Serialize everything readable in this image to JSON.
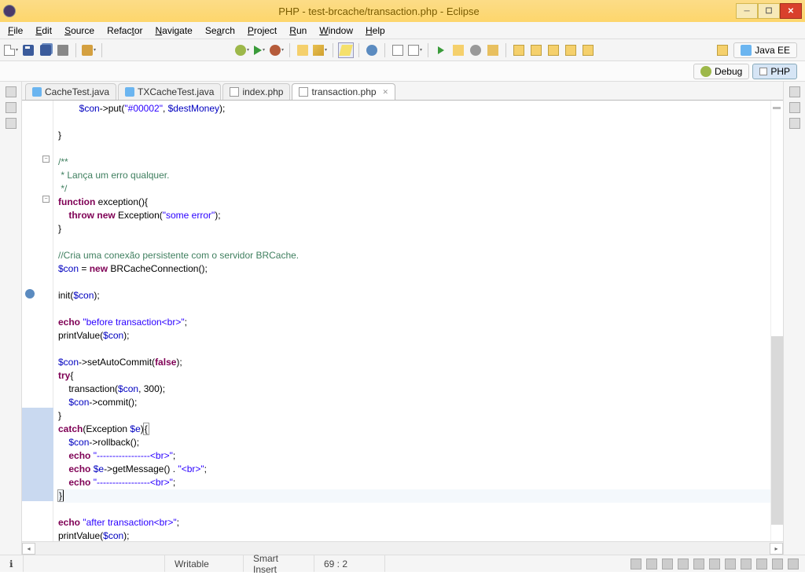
{
  "window": {
    "title": "PHP - test-brcache/transaction.php - Eclipse"
  },
  "menu": [
    "File",
    "Edit",
    "Source",
    "Refactor",
    "Navigate",
    "Search",
    "Project",
    "Run",
    "Window",
    "Help"
  ],
  "perspectives": {
    "java_ee": "Java EE",
    "debug": "Debug",
    "php": "PHP"
  },
  "tabs": [
    {
      "label": "CacheTest.java",
      "type": "j",
      "active": false
    },
    {
      "label": "TXCacheTest.java",
      "type": "j",
      "active": false
    },
    {
      "label": "index.php",
      "type": "p",
      "active": false
    },
    {
      "label": "transaction.php",
      "type": "p",
      "active": true
    }
  ],
  "code": {
    "lines": [
      {
        "indent": 2,
        "tokens": [
          {
            "c": "var",
            "t": "$con"
          },
          {
            "c": "",
            "t": "->put("
          },
          {
            "c": "str",
            "t": "\"#00002\""
          },
          {
            "c": "",
            "t": ", "
          },
          {
            "c": "var",
            "t": "$destMoney"
          },
          {
            "c": "",
            "t": ");"
          }
        ]
      },
      {
        "indent": 0,
        "tokens": []
      },
      {
        "indent": 0,
        "tokens": [
          {
            "c": "",
            "t": "}"
          }
        ]
      },
      {
        "indent": 0,
        "tokens": []
      },
      {
        "indent": 0,
        "fold": "-",
        "tokens": [
          {
            "c": "cm",
            "t": "/**"
          }
        ]
      },
      {
        "indent": 0,
        "tokens": [
          {
            "c": "cm",
            "t": " * Lança um erro qualquer."
          }
        ]
      },
      {
        "indent": 0,
        "tokens": [
          {
            "c": "cm",
            "t": " */"
          }
        ]
      },
      {
        "indent": 0,
        "fold": "-",
        "tokens": [
          {
            "c": "kw",
            "t": "function"
          },
          {
            "c": "",
            "t": " exception(){"
          }
        ]
      },
      {
        "indent": 1,
        "tokens": [
          {
            "c": "kw",
            "t": "throw"
          },
          {
            "c": "",
            "t": " "
          },
          {
            "c": "kw",
            "t": "new"
          },
          {
            "c": "",
            "t": " Exception("
          },
          {
            "c": "str",
            "t": "\"some error\""
          },
          {
            "c": "",
            "t": ");"
          }
        ]
      },
      {
        "indent": 0,
        "tokens": [
          {
            "c": "",
            "t": "}"
          }
        ]
      },
      {
        "indent": 0,
        "tokens": []
      },
      {
        "indent": 0,
        "tokens": [
          {
            "c": "cm",
            "t": "//Cria uma conexão persistente com o servidor BRCache."
          }
        ]
      },
      {
        "indent": 0,
        "tokens": [
          {
            "c": "var",
            "t": "$con"
          },
          {
            "c": "",
            "t": " = "
          },
          {
            "c": "kw",
            "t": "new"
          },
          {
            "c": "",
            "t": " BRCacheConnection();"
          }
        ]
      },
      {
        "indent": 0,
        "tokens": []
      },
      {
        "indent": 0,
        "warn": true,
        "tokens": [
          {
            "c": "",
            "t": "init("
          },
          {
            "c": "var",
            "t": "$con"
          },
          {
            "c": "",
            "t": ");"
          }
        ]
      },
      {
        "indent": 0,
        "tokens": []
      },
      {
        "indent": 0,
        "tokens": [
          {
            "c": "kw",
            "t": "echo"
          },
          {
            "c": "",
            "t": " "
          },
          {
            "c": "str",
            "t": "\"before transaction<br>\""
          },
          {
            "c": "",
            "t": ";"
          }
        ]
      },
      {
        "indent": 0,
        "tokens": [
          {
            "c": "",
            "t": "printValue("
          },
          {
            "c": "var",
            "t": "$con"
          },
          {
            "c": "",
            "t": ");"
          }
        ]
      },
      {
        "indent": 0,
        "tokens": []
      },
      {
        "indent": 0,
        "tokens": [
          {
            "c": "var",
            "t": "$con"
          },
          {
            "c": "",
            "t": "->setAutoCommit("
          },
          {
            "c": "kw",
            "t": "false"
          },
          {
            "c": "",
            "t": ");"
          }
        ]
      },
      {
        "indent": 0,
        "tokens": [
          {
            "c": "kw",
            "t": "try"
          },
          {
            "c": "",
            "t": "{"
          }
        ]
      },
      {
        "indent": 1,
        "tokens": [
          {
            "c": "",
            "t": "transaction("
          },
          {
            "c": "var",
            "t": "$con"
          },
          {
            "c": "",
            "t": ", 300);"
          }
        ]
      },
      {
        "indent": 1,
        "tokens": [
          {
            "c": "var",
            "t": "$con"
          },
          {
            "c": "",
            "t": "->commit();"
          }
        ]
      },
      {
        "indent": 0,
        "hl": true,
        "tokens": [
          {
            "c": "",
            "t": "}"
          }
        ]
      },
      {
        "indent": 0,
        "hl": true,
        "tokens": [
          {
            "c": "kw",
            "t": "catch"
          },
          {
            "c": "",
            "t": "(Exception "
          },
          {
            "c": "var",
            "t": "$e"
          },
          {
            "c": "",
            "t": ")"
          },
          {
            "c": "",
            "t": "{",
            "box": true
          }
        ]
      },
      {
        "indent": 1,
        "hl": true,
        "tokens": [
          {
            "c": "var",
            "t": "$con"
          },
          {
            "c": "",
            "t": "->rollback();"
          }
        ]
      },
      {
        "indent": 1,
        "hl": true,
        "tokens": [
          {
            "c": "kw",
            "t": "echo"
          },
          {
            "c": "",
            "t": " "
          },
          {
            "c": "str",
            "t": "\"-----------------<br>\""
          },
          {
            "c": "",
            "t": ";"
          }
        ]
      },
      {
        "indent": 1,
        "hl": true,
        "tokens": [
          {
            "c": "kw",
            "t": "echo"
          },
          {
            "c": "",
            "t": " "
          },
          {
            "c": "var",
            "t": "$e"
          },
          {
            "c": "",
            "t": "->getMessage() . "
          },
          {
            "c": "str",
            "t": "\"<br>\""
          },
          {
            "c": "",
            "t": ";"
          }
        ]
      },
      {
        "indent": 1,
        "hl": true,
        "tokens": [
          {
            "c": "kw",
            "t": "echo"
          },
          {
            "c": "",
            "t": " "
          },
          {
            "c": "str",
            "t": "\"-----------------<br>\""
          },
          {
            "c": "",
            "t": ";"
          }
        ]
      },
      {
        "indent": 0,
        "hl": true,
        "current": true,
        "tokens": [
          {
            "c": "",
            "t": "}",
            "box": true,
            "cursor": true
          }
        ]
      },
      {
        "indent": 0,
        "tokens": []
      },
      {
        "indent": 0,
        "tokens": [
          {
            "c": "kw",
            "t": "echo"
          },
          {
            "c": "",
            "t": " "
          },
          {
            "c": "str",
            "t": "\"after transaction<br>\""
          },
          {
            "c": "",
            "t": ";"
          }
        ]
      },
      {
        "indent": 0,
        "tokens": [
          {
            "c": "",
            "t": "printValue("
          },
          {
            "c": "var",
            "t": "$con"
          },
          {
            "c": "",
            "t": ");"
          }
        ]
      }
    ]
  },
  "status": {
    "writable": "Writable",
    "insert": "Smart Insert",
    "pos": "69 : 2"
  }
}
